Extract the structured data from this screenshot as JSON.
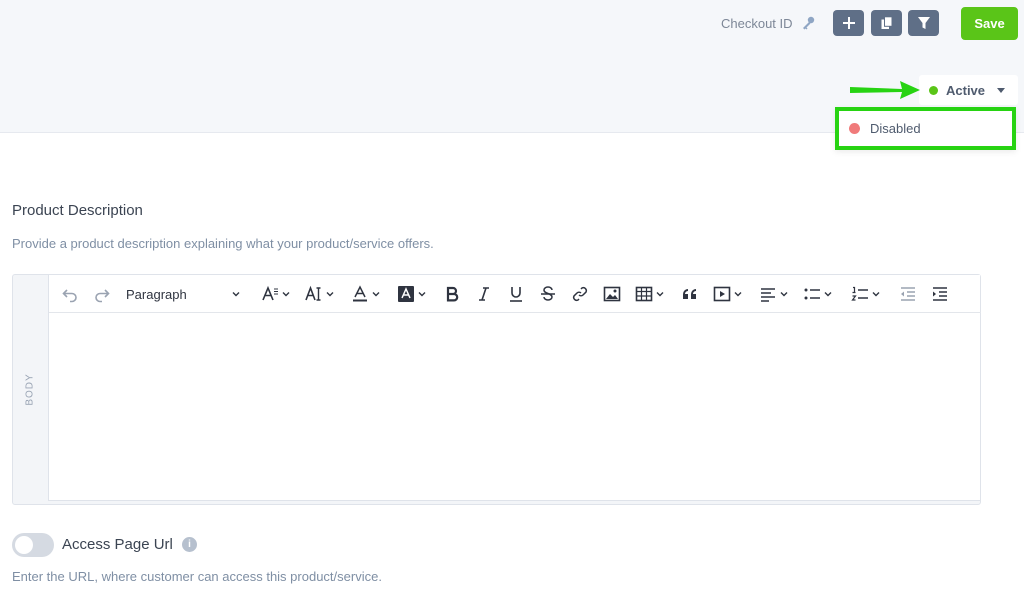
{
  "header": {
    "checkout_id_label": "Checkout ID",
    "save_label": "Save",
    "status": {
      "current": "Active",
      "options": [
        "Disabled"
      ]
    }
  },
  "description": {
    "title": "Product Description",
    "help": "Provide a product description explaining what your product/service offers.",
    "editor": {
      "side_label": "BODY",
      "block_format": "Paragraph",
      "body_text": ""
    }
  },
  "access_url": {
    "label": "Access Page Url",
    "help": "Enter the URL, where customer can access this product/service.",
    "enabled": false
  },
  "colors": {
    "accent": "#5ac518",
    "toolbar_buttons": "#5f6f87",
    "annotation": "#27d312",
    "disabled_dot": "#f07a7a"
  }
}
